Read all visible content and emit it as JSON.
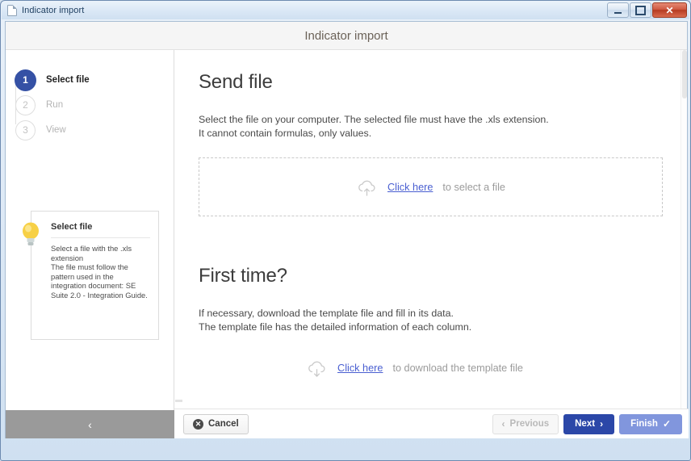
{
  "window": {
    "title": "Indicator import",
    "icon": "document-icon",
    "controls": {
      "minimize": "–",
      "maximize": "□",
      "close": "✕"
    }
  },
  "header": {
    "title": "Indicator import"
  },
  "sidebar": {
    "steps": [
      {
        "number": "1",
        "label": "Select file",
        "state": "active"
      },
      {
        "number": "2",
        "label": "Run",
        "state": "inactive"
      },
      {
        "number": "3",
        "label": "View",
        "state": "inactive"
      }
    ],
    "tip": {
      "icon": "lightbulb-icon",
      "title": "Select file",
      "text": "Select a file with the .xls extension\nThe file must follow the pattern used in the integration document: SE Suite 2.0 - Integration Guide."
    },
    "collapse": {
      "icon": "chevron-left-icon",
      "glyph": "‹"
    }
  },
  "main": {
    "send_file": {
      "title": "Send file",
      "description": "Select the file on your computer. The selected file must have the .xls extension.\nIt cannot contain formulas, only values.",
      "dropzone": {
        "icon": "cloud-upload-icon",
        "link": "Click here",
        "suffix": "to select a file"
      }
    },
    "first_time": {
      "title": "First time?",
      "description": "If necessary, download the template file and fill in its data.\nThe template file has the detailed information of each column.",
      "download": {
        "icon": "cloud-download-icon",
        "link": "Click here",
        "suffix": "to download the template file"
      }
    }
  },
  "footer": {
    "cancel": {
      "label": "Cancel",
      "icon": "circle-x-icon",
      "glyph": "✕"
    },
    "previous": {
      "label": "Previous",
      "icon": "chevron-left-icon",
      "glyph": "‹",
      "state": "disabled"
    },
    "next": {
      "label": "Next",
      "icon": "chevron-right-icon",
      "glyph": "›",
      "state": "primary"
    },
    "finish": {
      "label": "Finish",
      "icon": "check-icon",
      "glyph": "✓",
      "state": "secondary"
    }
  },
  "colors": {
    "accent": "#2b47a8",
    "accent_light": "#8196dd",
    "link": "#4a5fd1",
    "step_active": "#3551a5",
    "muted": "#9b9b9b",
    "collapse_bar": "#9a9a9a"
  }
}
